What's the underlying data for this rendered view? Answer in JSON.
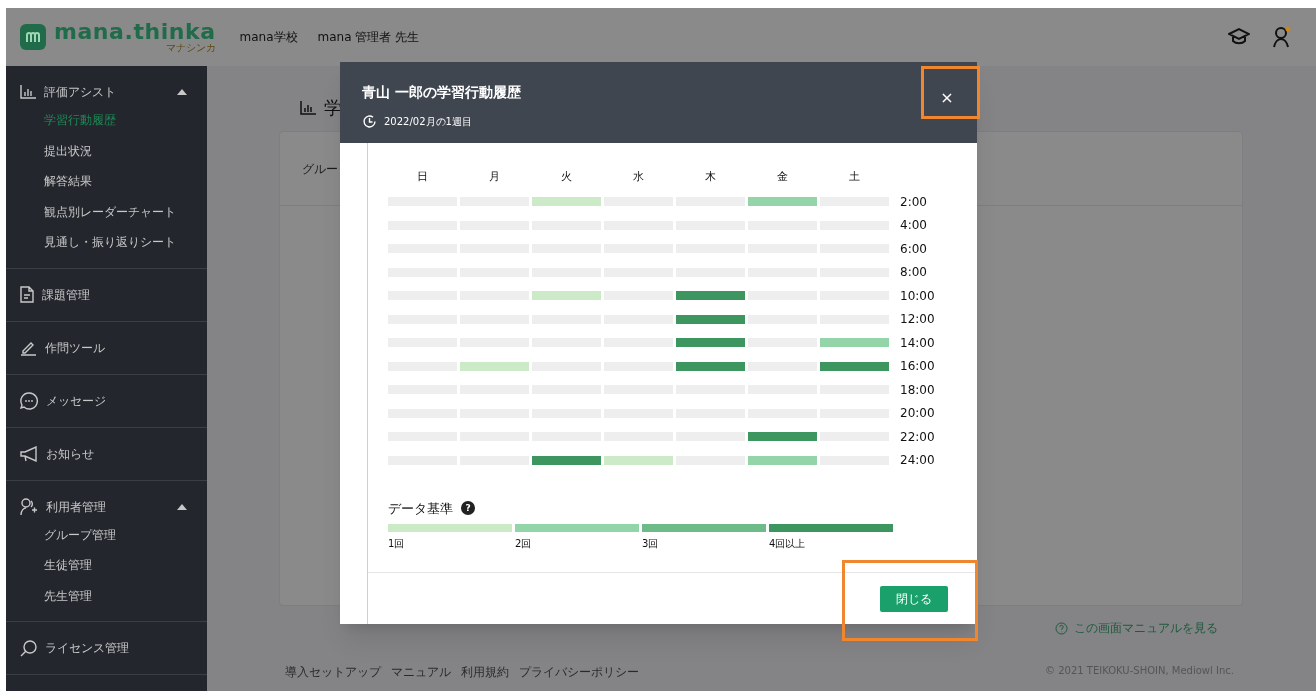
{
  "header": {
    "logo": "mana.thinka",
    "logo_sub": "マナシンカ",
    "school": "mana学校",
    "user": "mana 管理者 先生"
  },
  "sidebar": [
    {
      "label": "評価アシスト",
      "expanded": true,
      "children": [
        {
          "label": "学習行動履歴",
          "selected": true
        },
        {
          "label": "提出状況",
          "selected": false
        },
        {
          "label": "解答結果",
          "selected": false
        },
        {
          "label": "観点別レーダーチャート",
          "selected": false
        },
        {
          "label": "見通し・振り返りシート",
          "selected": false
        }
      ]
    },
    {
      "label": "課題管理"
    },
    {
      "label": "作問ツール"
    },
    {
      "label": "メッセージ"
    },
    {
      "label": "お知らせ"
    },
    {
      "label": "利用者管理",
      "expanded": true,
      "children": [
        {
          "label": "グループ管理",
          "selected": false
        },
        {
          "label": "生徒管理",
          "selected": false
        },
        {
          "label": "先生管理",
          "selected": false
        }
      ]
    },
    {
      "label": "ライセンス管理"
    }
  ],
  "main": {
    "title": "学",
    "filter_label": "グルー",
    "manual_link": "この画面マニュアルを見る",
    "footer_links": [
      "導入セットアップ",
      "マニュアル",
      "利用規約",
      "プライバシーポリシー"
    ],
    "copyright": "© 2021 TEIKOKU-SHOIN, Mediowl Inc."
  },
  "modal": {
    "title": "青山 一郎の学習行動履歴",
    "period": "2022/02月の1週目",
    "close": "×",
    "days": [
      "日",
      "月",
      "火",
      "水",
      "木",
      "金",
      "土"
    ],
    "rows": [
      {
        "time": "2:00",
        "cells": [
          {
            "color": "#eeeeee"
          },
          {
            "color": "#eeeeee"
          },
          {
            "color": "#cdeac8"
          },
          {
            "color": "#eeeeee"
          },
          {
            "color": "#eeeeee"
          },
          {
            "color": "#93d5a8"
          },
          {
            "color": "#eeeeee"
          }
        ]
      },
      {
        "time": "4:00",
        "cells": [
          {
            "color": "#eeeeee"
          },
          {
            "color": "#eeeeee"
          },
          {
            "color": "#eeeeee"
          },
          {
            "color": "#eeeeee"
          },
          {
            "color": "#eeeeee"
          },
          {
            "color": "#eeeeee"
          },
          {
            "color": "#eeeeee"
          }
        ]
      },
      {
        "time": "6:00",
        "cells": [
          {
            "color": "#eeeeee"
          },
          {
            "color": "#eeeeee"
          },
          {
            "color": "#eeeeee"
          },
          {
            "color": "#eeeeee"
          },
          {
            "color": "#eeeeee"
          },
          {
            "color": "#eeeeee"
          },
          {
            "color": "#eeeeee"
          }
        ]
      },
      {
        "time": "8:00",
        "cells": [
          {
            "color": "#eeeeee"
          },
          {
            "color": "#eeeeee"
          },
          {
            "color": "#eeeeee"
          },
          {
            "color": "#eeeeee"
          },
          {
            "color": "#eeeeee"
          },
          {
            "color": "#eeeeee"
          },
          {
            "color": "#eeeeee"
          }
        ]
      },
      {
        "time": "10:00",
        "cells": [
          {
            "color": "#eeeeee"
          },
          {
            "color": "#eeeeee"
          },
          {
            "color": "#cdeac8"
          },
          {
            "color": "#eeeeee"
          },
          {
            "color": "#3d9660"
          },
          {
            "color": "#eeeeee"
          },
          {
            "color": "#eeeeee"
          }
        ]
      },
      {
        "time": "12:00",
        "cells": [
          {
            "color": "#eeeeee"
          },
          {
            "color": "#eeeeee"
          },
          {
            "color": "#eeeeee"
          },
          {
            "color": "#eeeeee"
          },
          {
            "color": "#3d9660"
          },
          {
            "color": "#eeeeee"
          },
          {
            "color": "#eeeeee"
          }
        ]
      },
      {
        "time": "14:00",
        "cells": [
          {
            "color": "#eeeeee"
          },
          {
            "color": "#eeeeee"
          },
          {
            "color": "#eeeeee"
          },
          {
            "color": "#eeeeee"
          },
          {
            "color": "#3d9660"
          },
          {
            "color": "#eeeeee"
          },
          {
            "color": "#93d5a8"
          }
        ]
      },
      {
        "time": "16:00",
        "cells": [
          {
            "color": "#eeeeee"
          },
          {
            "color": "#cdeac8"
          },
          {
            "color": "#eeeeee"
          },
          {
            "color": "#eeeeee"
          },
          {
            "color": "#3d9660"
          },
          {
            "color": "#eeeeee"
          },
          {
            "color": "#3d9660"
          }
        ]
      },
      {
        "time": "18:00",
        "cells": [
          {
            "color": "#eeeeee"
          },
          {
            "color": "#eeeeee"
          },
          {
            "color": "#eeeeee"
          },
          {
            "color": "#eeeeee"
          },
          {
            "color": "#eeeeee"
          },
          {
            "color": "#eeeeee"
          },
          {
            "color": "#eeeeee"
          }
        ]
      },
      {
        "time": "20:00",
        "cells": [
          {
            "color": "#eeeeee"
          },
          {
            "color": "#eeeeee"
          },
          {
            "color": "#eeeeee"
          },
          {
            "color": "#eeeeee"
          },
          {
            "color": "#eeeeee"
          },
          {
            "color": "#eeeeee"
          },
          {
            "color": "#eeeeee"
          }
        ]
      },
      {
        "time": "22:00",
        "cells": [
          {
            "color": "#eeeeee"
          },
          {
            "color": "#eeeeee"
          },
          {
            "color": "#eeeeee"
          },
          {
            "color": "#eeeeee"
          },
          {
            "color": "#eeeeee"
          },
          {
            "color": "#3d9660"
          },
          {
            "color": "#eeeeee"
          }
        ]
      },
      {
        "time": "24:00",
        "cells": [
          {
            "color": "#eeeeee"
          },
          {
            "color": "#eeeeee"
          },
          {
            "color": "#3d9660"
          },
          {
            "color": "#cdeac8"
          },
          {
            "color": "#eeeeee"
          },
          {
            "color": "#93d5a8"
          },
          {
            "color": "#eeeeee"
          }
        ]
      }
    ],
    "legend_title": "データ基準",
    "legend_help": "?",
    "legend": [
      {
        "label": "1回",
        "color": "#cdeac8"
      },
      {
        "label": "2回",
        "color": "#93d5a8"
      },
      {
        "label": "3回",
        "color": "#6dbb88"
      },
      {
        "label": "4回以上",
        "color": "#3d9660"
      }
    ],
    "button": "閉じる"
  }
}
